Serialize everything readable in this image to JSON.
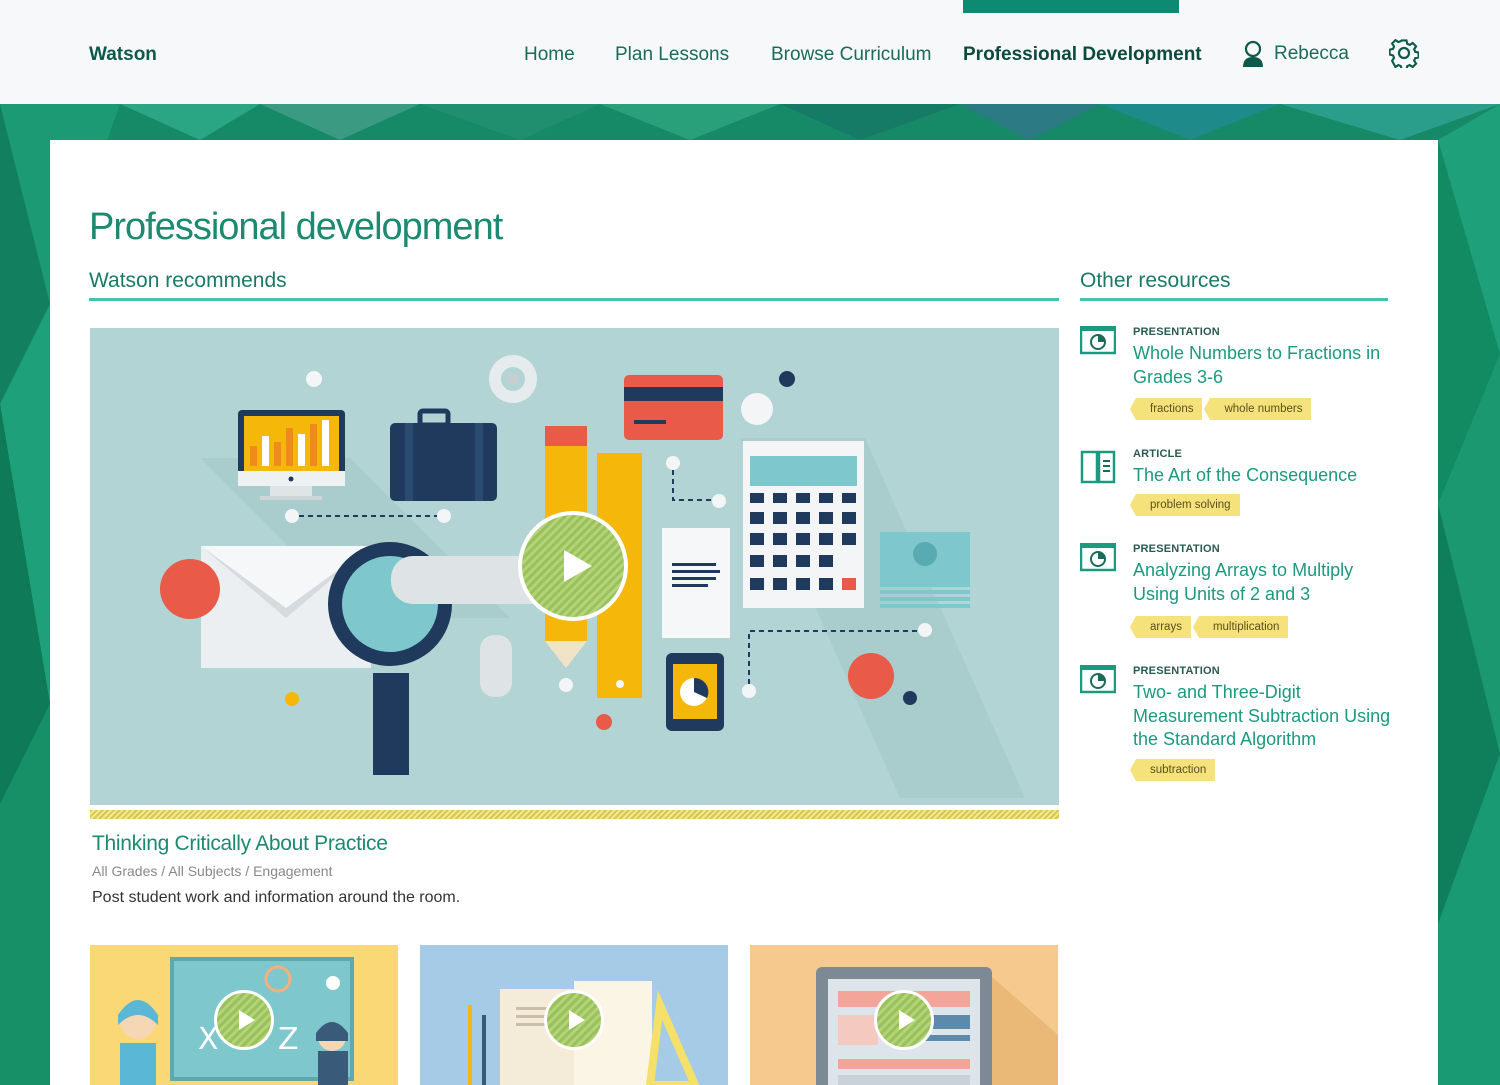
{
  "app": {
    "brand": "Watson"
  },
  "nav": {
    "items": [
      {
        "label": "Home"
      },
      {
        "label": "Plan Lessons"
      },
      {
        "label": "Browse Curriculum"
      },
      {
        "label": "Professional Development"
      }
    ],
    "active": "Professional Development",
    "user": "Rebecca"
  },
  "page": {
    "title": "Professional development",
    "recommends_heading": "Watson recommends",
    "other_heading": "Other resources"
  },
  "featured": {
    "title": "Thinking Critically About Practice",
    "meta": "All Grades / All Subjects / Engagement",
    "description": "Post student work and information around the room."
  },
  "resources": [
    {
      "type": "PRESENTATION",
      "title": "Whole Numbers to Fractions in Grades 3-6",
      "tags": [
        "fractions",
        "whole numbers"
      ],
      "icon": "presentation-icon"
    },
    {
      "type": "ARTICLE",
      "title": "The Art of the Consequence",
      "tags": [
        "problem solving"
      ],
      "icon": "article-icon"
    },
    {
      "type": "PRESENTATION",
      "title": "Analyzing Arrays to Multiply Using Units of 2 and 3",
      "tags": [
        "arrays",
        "multiplication"
      ],
      "icon": "presentation-icon"
    },
    {
      "type": "PRESENTATION",
      "title": "Two- and Three-Digit Measurement Subtraction Using the Standard Algorithm",
      "tags": [
        "subtraction"
      ],
      "icon": "presentation-icon"
    }
  ],
  "colors": {
    "accent": "#1b8a70",
    "rule": "#45c1b0",
    "tag": "#f6e27a",
    "nav_active": "#0d8a72"
  }
}
